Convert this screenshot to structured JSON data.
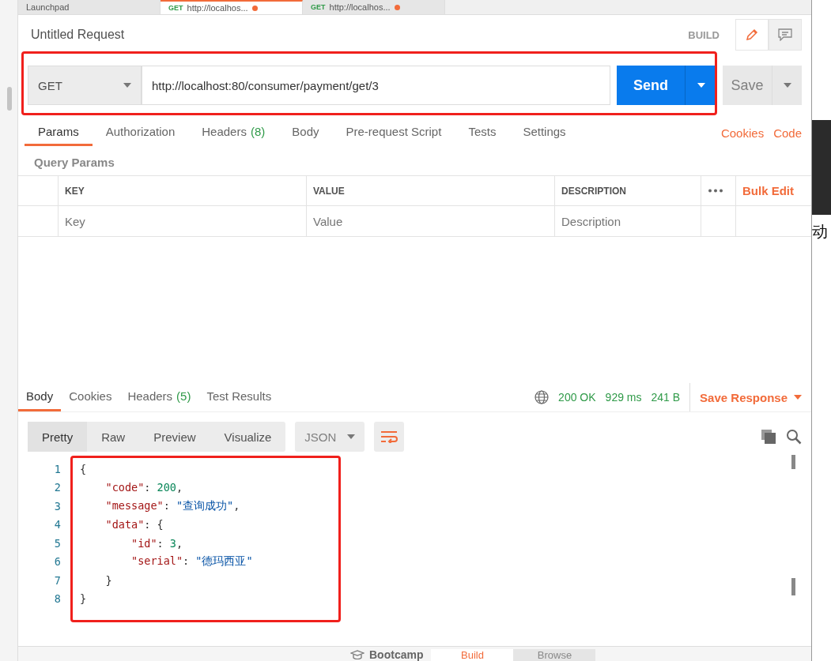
{
  "top_tabs": [
    {
      "label": "Launchpad",
      "selected": false,
      "unsaved": false
    },
    {
      "method": "GET",
      "label": "http://localhos...",
      "selected": true,
      "unsaved": true
    },
    {
      "method": "GET",
      "label": "http://localhos...",
      "selected": false,
      "unsaved": true
    }
  ],
  "request": {
    "title": "Untitled Request",
    "mode": "BUILD",
    "method": "GET",
    "url": "http://localhost:80/consumer/payment/get/3",
    "send": "Send",
    "save": "Save"
  },
  "request_tabs": [
    {
      "label": "Params",
      "selected": true
    },
    {
      "label": "Authorization",
      "selected": false
    },
    {
      "label": "Headers",
      "count": "(8)",
      "selected": false
    },
    {
      "label": "Body",
      "selected": false
    },
    {
      "label": "Pre-request Script",
      "selected": false
    },
    {
      "label": "Tests",
      "selected": false
    },
    {
      "label": "Settings",
      "selected": false
    }
  ],
  "request_links": [
    "Cookies",
    "Code"
  ],
  "query_params": {
    "title": "Query Params",
    "columns": [
      "KEY",
      "VALUE",
      "DESCRIPTION"
    ],
    "bulk_edit": "Bulk Edit",
    "placeholders": [
      "Key",
      "Value",
      "Description"
    ]
  },
  "response_tabs": [
    {
      "label": "Body",
      "selected": true
    },
    {
      "label": "Cookies",
      "selected": false
    },
    {
      "label": "Headers",
      "count": "(5)",
      "selected": false
    },
    {
      "label": "Test Results",
      "selected": false
    }
  ],
  "response_status": {
    "status": "200 OK",
    "time": "929 ms",
    "size": "241 B",
    "save": "Save Response"
  },
  "view_modes": [
    {
      "label": "Pretty",
      "selected": true
    },
    {
      "label": "Raw",
      "selected": false
    },
    {
      "label": "Preview",
      "selected": false
    },
    {
      "label": "Visualize",
      "selected": false
    }
  ],
  "format": "JSON",
  "code_lines": [
    {
      "number": "1",
      "tokens": [
        {
          "kind": "punct",
          "text": "{"
        }
      ]
    },
    {
      "number": "2",
      "tokens": [
        {
          "kind": "key",
          "text": "    \"code\""
        },
        {
          "kind": "punct",
          "text": ": "
        },
        {
          "kind": "number",
          "text": "200"
        },
        {
          "kind": "punct",
          "text": ","
        }
      ]
    },
    {
      "number": "3",
      "tokens": [
        {
          "kind": "key",
          "text": "    \"message\""
        },
        {
          "kind": "punct",
          "text": ": "
        },
        {
          "kind": "string",
          "text": "\"查询成功\""
        },
        {
          "kind": "punct",
          "text": ","
        }
      ]
    },
    {
      "number": "4",
      "tokens": [
        {
          "kind": "key",
          "text": "    \"data\""
        },
        {
          "kind": "punct",
          "text": ": {"
        }
      ]
    },
    {
      "number": "5",
      "tokens": [
        {
          "kind": "key",
          "text": "        \"id\""
        },
        {
          "kind": "punct",
          "text": ": "
        },
        {
          "kind": "number",
          "text": "3"
        },
        {
          "kind": "punct",
          "text": ","
        }
      ]
    },
    {
      "number": "6",
      "tokens": [
        {
          "kind": "key",
          "text": "        \"serial\""
        },
        {
          "kind": "punct",
          "text": ": "
        },
        {
          "kind": "string",
          "text": "\"德玛西亚\""
        }
      ]
    },
    {
      "number": "7",
      "tokens": [
        {
          "kind": "punct",
          "text": "    }"
        }
      ]
    },
    {
      "number": "8",
      "tokens": [
        {
          "kind": "punct",
          "text": "}"
        }
      ]
    }
  ],
  "bottom_bar": {
    "bootcamp": "Bootcamp",
    "modes": [
      {
        "label": "Build",
        "selected": true
      },
      {
        "label": "Browse",
        "selected": false
      }
    ]
  },
  "background_text": "动"
}
